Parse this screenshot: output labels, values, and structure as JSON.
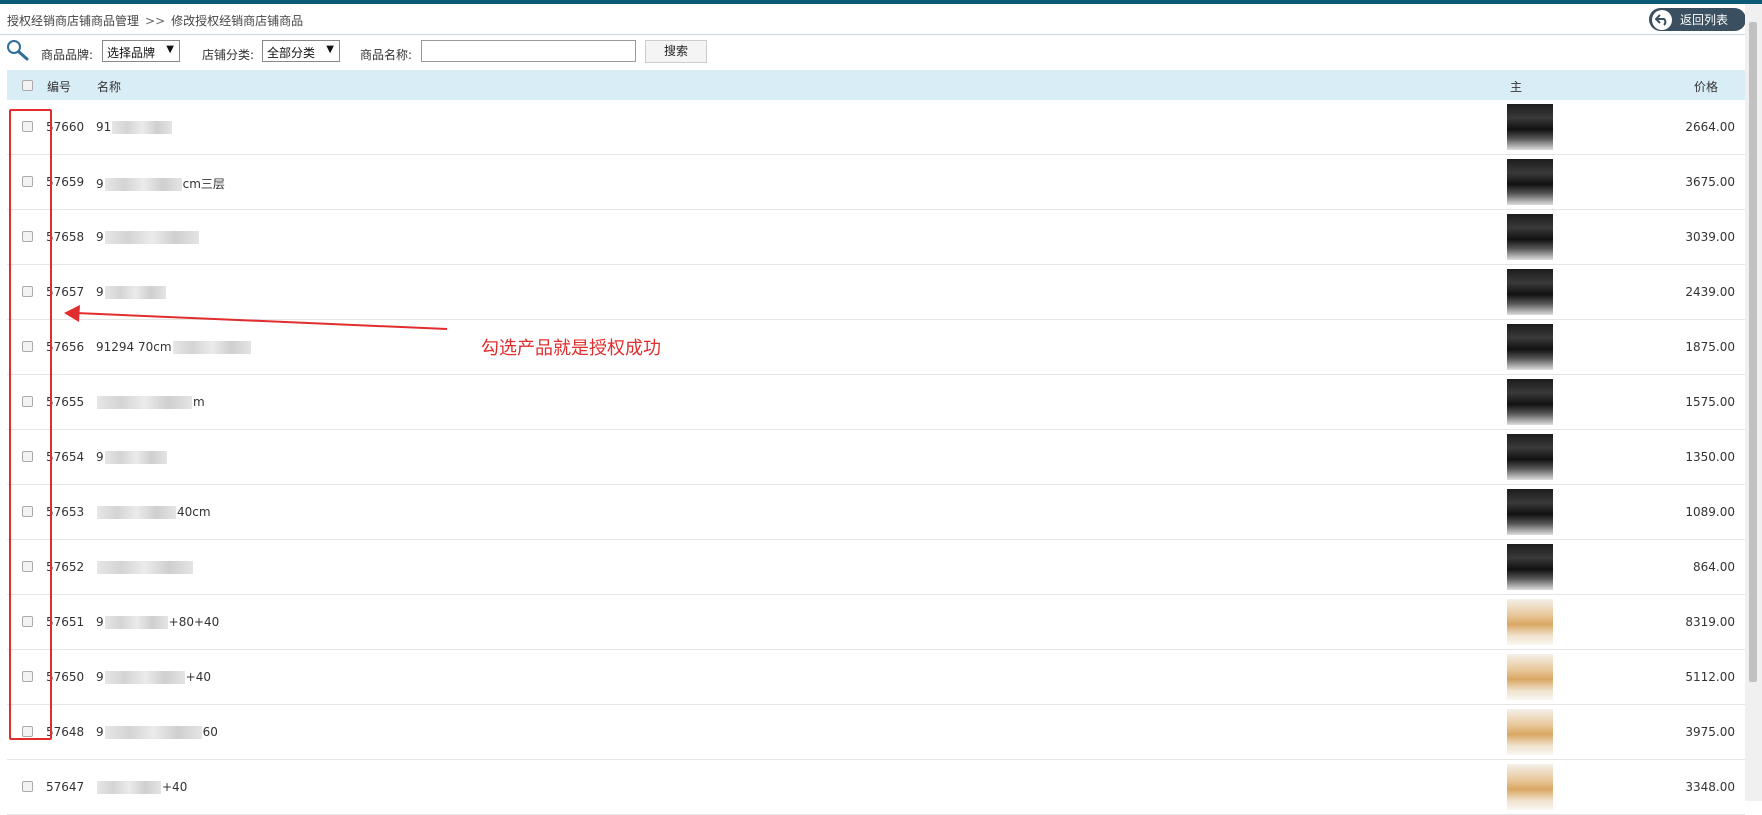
{
  "breadcrumb": {
    "part1": "授权经销商店铺商品管理",
    "separator": ">>",
    "part2": "修改授权经销商店铺商品"
  },
  "back_button": {
    "label": "返回列表"
  },
  "search": {
    "brand_label": "商品品牌:",
    "brand_value": "选择品牌",
    "category_label": "店铺分类:",
    "category_value": "全部分类",
    "name_label": "商品名称:",
    "name_value": "",
    "search_button": "搜索"
  },
  "table": {
    "headers": {
      "id": "编号",
      "name": "名称",
      "image": "主",
      "price": "价格"
    },
    "rows": [
      {
        "id": "57660",
        "name_prefix": "91",
        "name_suffix": "",
        "price": "2664.00",
        "img": "dark"
      },
      {
        "id": "57659",
        "name_prefix": "9",
        "name_suffix": "cm三层",
        "price": "3675.00",
        "img": "dark"
      },
      {
        "id": "57658",
        "name_prefix": "9",
        "name_suffix": "",
        "price": "3039.00",
        "img": "dark"
      },
      {
        "id": "57657",
        "name_prefix": "9",
        "name_suffix": "",
        "price": "2439.00",
        "img": "dark"
      },
      {
        "id": "57656",
        "name_prefix": "91294 70cm",
        "name_suffix": "",
        "price": "1875.00",
        "img": "dark"
      },
      {
        "id": "57655",
        "name_prefix": "",
        "name_suffix": "m",
        "price": "1575.00",
        "img": "dark"
      },
      {
        "id": "57654",
        "name_prefix": "9",
        "name_suffix": "",
        "price": "1350.00",
        "img": "dark"
      },
      {
        "id": "57653",
        "name_prefix": "",
        "name_suffix": "40cm",
        "price": "1089.00",
        "img": "dark"
      },
      {
        "id": "57652",
        "name_prefix": "",
        "name_suffix": "",
        "price": "864.00",
        "img": "dark"
      },
      {
        "id": "57651",
        "name_prefix": "9",
        "name_suffix": "+80+40",
        "price": "8319.00",
        "img": "light"
      },
      {
        "id": "57650",
        "name_prefix": "9",
        "name_suffix": "+40",
        "price": "5112.00",
        "img": "light"
      },
      {
        "id": "57648",
        "name_prefix": "9",
        "name_suffix": "60",
        "price": "3975.00",
        "img": "light"
      },
      {
        "id": "57647",
        "name_prefix": "",
        "name_suffix": "+40",
        "price": "3348.00",
        "img": "light"
      }
    ]
  },
  "annotation": {
    "text": "勾选产品就是授权成功",
    "color": "#e12d2d"
  },
  "colors": {
    "header_bg": "#d9edf7",
    "topbar": "#0d5a78",
    "back_button_bg": "#3a4f5f"
  }
}
